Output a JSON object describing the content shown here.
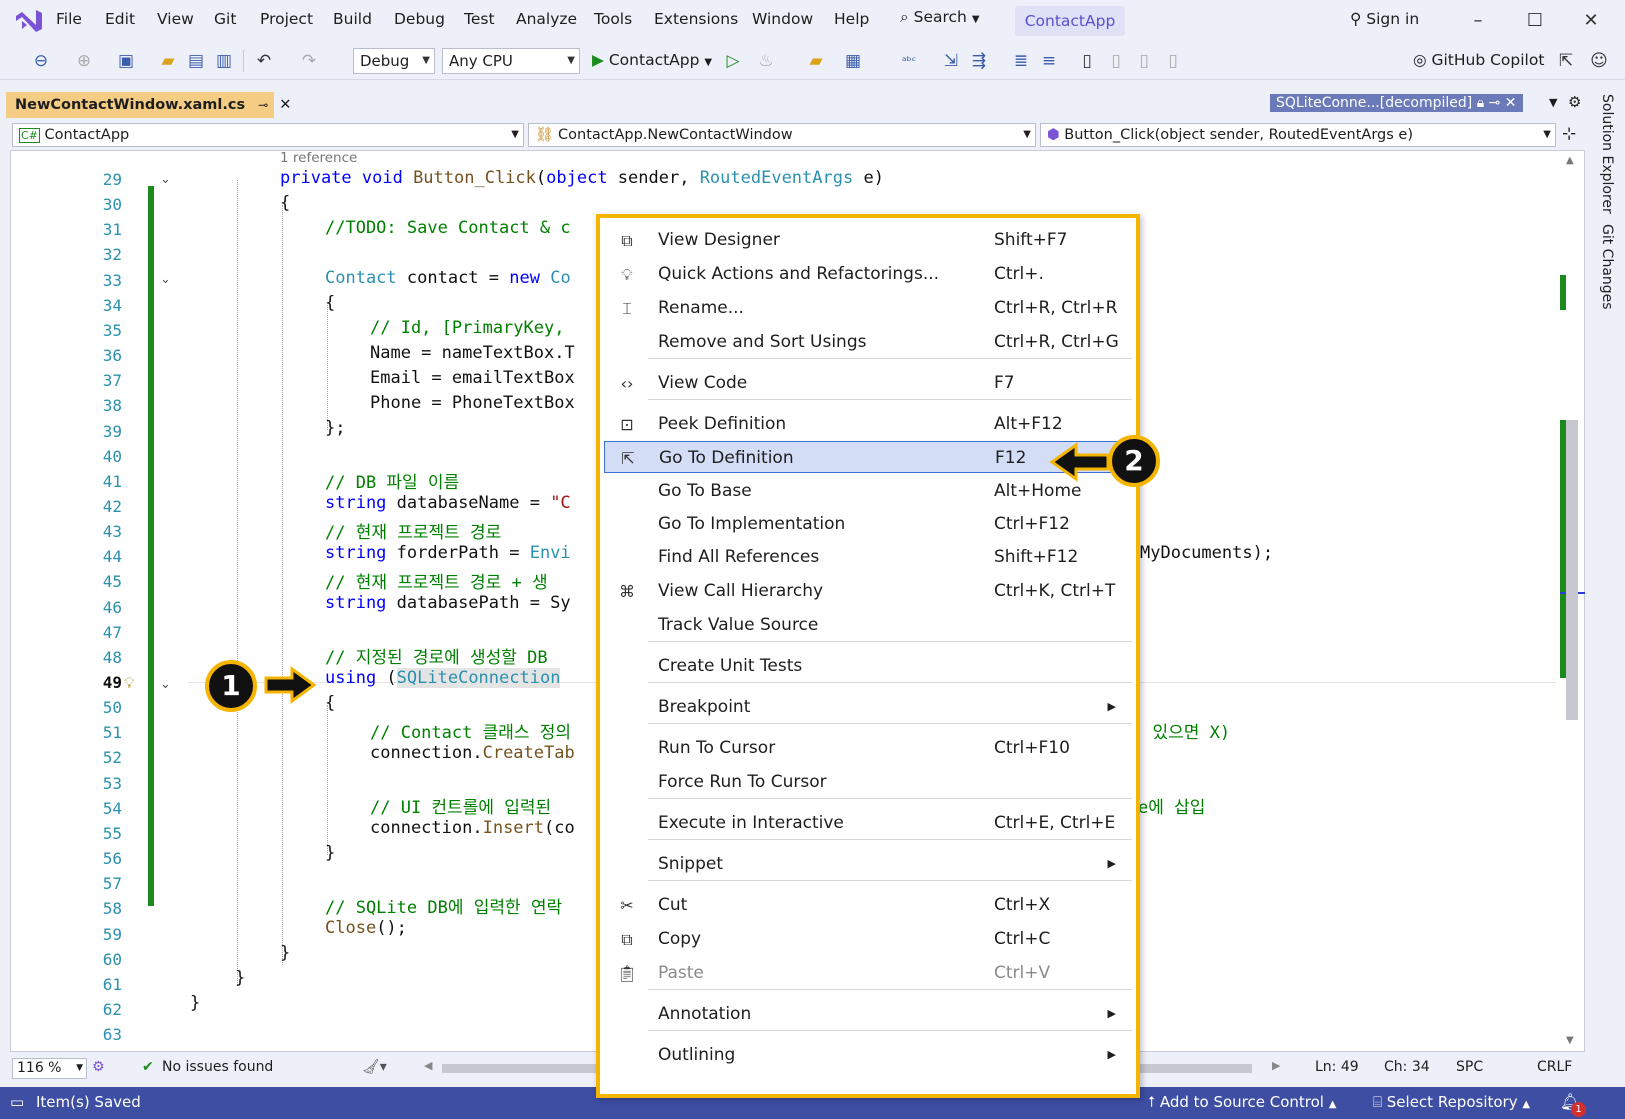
{
  "menubar": {
    "items": [
      "File",
      "Edit",
      "View",
      "Git",
      "Project",
      "Build",
      "Debug",
      "Test",
      "Analyze",
      "Tools",
      "Extensions",
      "Window",
      "Help"
    ],
    "search": "Search",
    "app_name": "ContactApp",
    "sign_in": "Sign in"
  },
  "toolbar": {
    "config": "Debug",
    "platform": "Any CPU",
    "run": "ContactApp",
    "copilot": "GitHub Copilot"
  },
  "tabs": {
    "active": "NewContactWindow.xaml.cs",
    "other": "SQLiteConne...[decompiled]"
  },
  "navbar": {
    "project": "ContactApp",
    "class": "ContactApp.NewContactWindow",
    "member": "Button_Click(object sender, RoutedEventArgs e)"
  },
  "editor": {
    "reference_hint": "1 reference",
    "line_numbers": [
      "29",
      "30",
      "31",
      "32",
      "33",
      "34",
      "35",
      "36",
      "37",
      "38",
      "39",
      "40",
      "41",
      "42",
      "43",
      "44",
      "45",
      "46",
      "47",
      "48",
      "49",
      "50",
      "51",
      "52",
      "53",
      "54",
      "55",
      "56",
      "57",
      "58",
      "59",
      "60",
      "61",
      "62",
      "63"
    ],
    "current_line": "49",
    "code": {
      "l29a": "private void ",
      "l29b": "Button_Click",
      "l29c": "(",
      "l29d": "object",
      " l29e": "",
      "l29f": " sender, ",
      "l29g": "RoutedEventArgs",
      "l29h": " e)",
      "l30": "{",
      "l31": "//TODO: Save Contact & c",
      "l33a": "Contact",
      "l33b": " contact = ",
      "l33c": "new",
      "l33d": " Co",
      "l34": "{",
      "l35": "// Id, [PrimaryKey,",
      "l36": "Name = nameTextBox.T",
      "l37": "Email = emailTextBox",
      "l38": "Phone = PhoneTextBox",
      "l39": "};",
      "l41": "// DB 파일 이름",
      "l42a": "string",
      "l42b": " databaseName = ",
      "l42c": "\"C",
      "l43": "// 현재 프로젝트 경로",
      "l44a": "string",
      "l44b": " forderPath = ",
      "l44c": "Envi",
      "l44tail": "MyDocuments);",
      "l45": "// 현재 프로젝트 경로 + 생",
      "l46a": "string",
      "l46b": " databasePath = Sy",
      "l48": "// 지정된 경로에 생성할 DB",
      "l49a": "using",
      "l49b": " (",
      "l49c": "SQLiteConnection",
      "l50": "{",
      "l51": "// Contact 클래스 정의",
      "l51tail": ", 있으면 X)",
      "l52a": "connection.",
      "l52b": "CreateTab",
      "l54": "// UI 컨트롤에 입력된",
      "l54tail": "e에 삽입",
      "l55a": "connection.",
      "l55b": "Insert",
      "l55c": "(co",
      "l56": "}",
      "l58": "// SQLite DB에 입력한 연락",
      "l59a": "Close",
      "l59b": "();",
      "l60": "}",
      "l61": "}",
      "l62": "}"
    }
  },
  "context_menu": [
    {
      "label": "View Designer",
      "shortcut": "Shift+F7",
      "icon": "designer-icon"
    },
    {
      "label": "Quick Actions and Refactorings...",
      "shortcut": "Ctrl+.",
      "icon": "lightbulb-icon"
    },
    {
      "label": "Rename...",
      "shortcut": "Ctrl+R, Ctrl+R",
      "icon": "rename-icon"
    },
    {
      "label": "Remove and Sort Usings",
      "shortcut": "Ctrl+R, Ctrl+G"
    },
    {
      "label": "View Code",
      "shortcut": "F7",
      "icon": "code-icon"
    },
    {
      "label": "Peek Definition",
      "shortcut": "Alt+F12",
      "icon": "peek-icon"
    },
    {
      "label": "Go To Definition",
      "shortcut": "F12",
      "icon": "goto-definition-icon"
    },
    {
      "label": "Go To Base",
      "shortcut": "Alt+Home"
    },
    {
      "label": "Go To Implementation",
      "shortcut": "Ctrl+F12"
    },
    {
      "label": "Find All References",
      "shortcut": "Shift+F12"
    },
    {
      "label": "View Call Hierarchy",
      "shortcut": "Ctrl+K, Ctrl+T",
      "icon": "call-hierarchy-icon"
    },
    {
      "label": "Track Value Source",
      "shortcut": ""
    },
    {
      "label": "Create Unit Tests",
      "shortcut": ""
    },
    {
      "label": "Breakpoint",
      "shortcut": ""
    },
    {
      "label": "Run To Cursor",
      "shortcut": "Ctrl+F10"
    },
    {
      "label": "Force Run To Cursor",
      "shortcut": ""
    },
    {
      "label": "Execute in Interactive",
      "shortcut": "Ctrl+E, Ctrl+E"
    },
    {
      "label": "Snippet",
      "shortcut": ""
    },
    {
      "label": "Cut",
      "shortcut": "Ctrl+X",
      "icon": "scissors-icon"
    },
    {
      "label": "Copy",
      "shortcut": "Ctrl+C",
      "icon": "copy-icon"
    },
    {
      "label": "Paste",
      "shortcut": "Ctrl+V",
      "icon": "paste-icon"
    },
    {
      "label": "Annotation",
      "shortcut": ""
    },
    {
      "label": "Outlining",
      "shortcut": ""
    }
  ],
  "annotations": {
    "badge1": "1",
    "badge2": "2"
  },
  "status": {
    "zoom": "116 %",
    "issues": "No issues found",
    "ln": "Ln: 49",
    "ch": "Ch: 34",
    "spc": "SPC",
    "crlf": "CRLF"
  },
  "bottombar": {
    "saved": "Item(s) Saved",
    "source_control": "Add to Source Control",
    "repo": "Select Repository",
    "notif_count": "1"
  },
  "side": {
    "solution_explorer": "Solution Explorer",
    "git_changes": "Git Changes"
  },
  "colors": {
    "accent": "#f4b400",
    "statusbar": "#3d4ea3",
    "keyword": "#0000ff",
    "type": "#2b91af",
    "comment": "#008000"
  }
}
